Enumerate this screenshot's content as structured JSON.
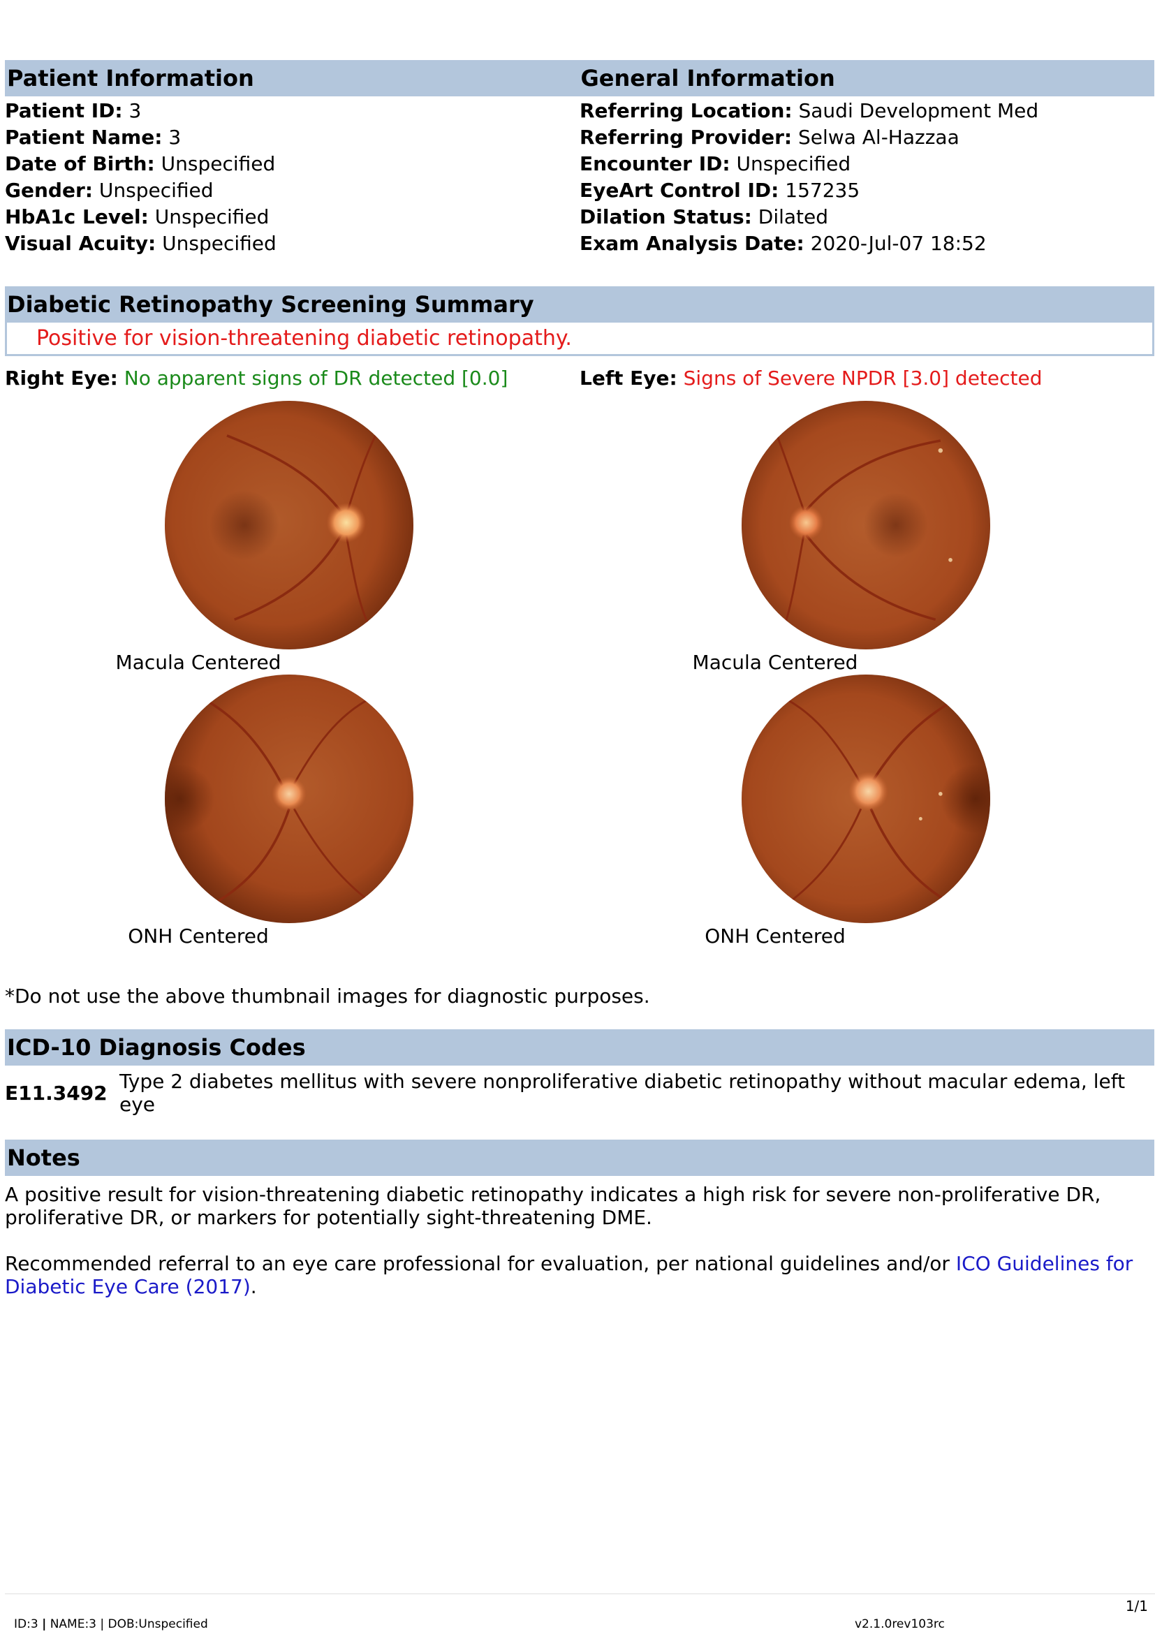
{
  "patient_info": {
    "title": "Patient Information",
    "rows": [
      {
        "label": "Patient ID:",
        "value": "3"
      },
      {
        "label": "Patient Name:",
        "value": "3"
      },
      {
        "label": "Date of Birth:",
        "value": "Unspecified"
      },
      {
        "label": "Gender:",
        "value": "Unspecified"
      },
      {
        "label": "HbA1c Level:",
        "value": "Unspecified"
      },
      {
        "label": "Visual Acuity:",
        "value": "Unspecified"
      }
    ]
  },
  "general_info": {
    "title": "General Information",
    "rows": [
      {
        "label": "Referring Location:",
        "value": "Saudi Development Med"
      },
      {
        "label": "Referring Provider:",
        "value": "Selwa Al-Hazzaa"
      },
      {
        "label": "Encounter ID:",
        "value": "Unspecified"
      },
      {
        "label": "EyeArt Control ID:",
        "value": "157235"
      },
      {
        "label": "Dilation Status:",
        "value": "Dilated"
      },
      {
        "label": "Exam Analysis Date:",
        "value": "2020-Jul-07 18:52"
      }
    ]
  },
  "summary": {
    "title": "Diabetic Retinopathy Screening Summary",
    "result": "Positive for vision-threatening diabetic retinopathy.",
    "right_eye_label": "Right Eye:",
    "right_eye_value": "No apparent signs of DR detected [0.0]",
    "left_eye_label": "Left Eye:",
    "left_eye_value": "Signs of Severe NPDR [3.0] detected",
    "captions": {
      "right_top": "Macula Centered",
      "left_top": "Macula Centered",
      "right_bottom": "ONH Centered",
      "left_bottom": "ONH Centered"
    },
    "disclaimer": "*Do not use the above thumbnail images for diagnostic purposes."
  },
  "icd": {
    "title": "ICD-10 Diagnosis Codes",
    "code": "E11.3492",
    "description": "Type 2 diabetes mellitus with severe nonproliferative diabetic retinopathy without macular edema, left eye"
  },
  "notes": {
    "title": "Notes",
    "paragraph1": "A positive result for vision-threatening diabetic retinopathy indicates a high risk for severe non-proliferative DR, proliferative DR, or markers for potentially sight-threatening DME.",
    "paragraph2_prefix": "Recommended referral to an eye care professional for evaluation, per national guidelines and/or ",
    "link_text": "ICO Guidelines for Diabetic Eye Care (2017)",
    "paragraph2_suffix": "."
  },
  "footer": {
    "page": "1/1",
    "id_part": "ID:3",
    "name_part": "NAME:3",
    "dob_part": "DOB:Unspecified",
    "version": "v2.1.0rev103rc"
  },
  "colors": {
    "header_band": "#b3c6dc",
    "positive": "#e41b1b",
    "negative": "#1a8a1a",
    "link": "#1a1ac8"
  }
}
